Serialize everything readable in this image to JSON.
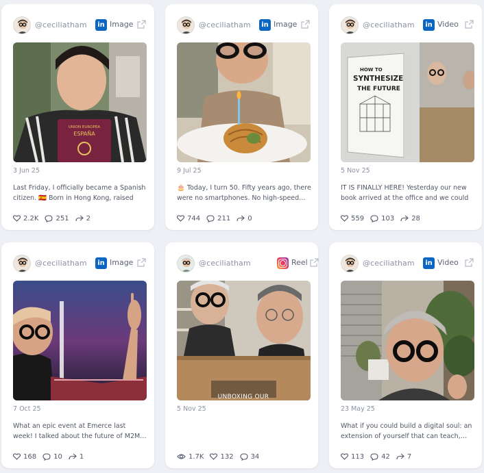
{
  "posts": [
    {
      "handle": "@ceciliatham",
      "platform": "linkedin",
      "media_type": "Image",
      "date": "3 Jun 25",
      "caption": "Last Friday, I officially became a Spanish citizen. 🇪🇸 Born in Hong Kong, raised in…",
      "stats": {
        "likes": "2.2K",
        "comments": "251",
        "shares": "2"
      },
      "thumbnail_text": {
        "passport_line1": "UNION EUROPEA",
        "passport_line2": "ESPAÑA"
      }
    },
    {
      "handle": "@ceciliatham",
      "platform": "linkedin",
      "media_type": "Image",
      "date": "9 Jul 25",
      "caption": "🎂 Today, I turn 50. Fifty years ago, there were no smartphones. No high-speed…",
      "stats": {
        "likes": "744",
        "comments": "211",
        "shares": "0"
      }
    },
    {
      "handle": "@ceciliatham",
      "platform": "linkedin",
      "media_type": "Video",
      "date": "5 Nov 25",
      "caption": "IT IS FINALLY HERE! Yesterday our new book arrived at the office and we could not be…",
      "stats": {
        "likes": "559",
        "comments": "103",
        "shares": "28"
      },
      "thumbnail_text": {
        "book_title_1": "HOW TO",
        "book_title_2": "SYNTHESIZE",
        "book_title_3": "THE FUTURE"
      }
    },
    {
      "handle": "@ceciliatham",
      "platform": "linkedin",
      "media_type": "Image",
      "date": "7 Oct 25",
      "caption": "What an epic event at Emerce last week! I talked about the future of M2M…",
      "stats": {
        "likes": "168",
        "comments": "10",
        "shares": "1"
      }
    },
    {
      "handle": "@ceciliatham",
      "platform": "instagram",
      "media_type": "Reel",
      "date": "5 Nov 25",
      "caption": "",
      "stats": {
        "views": "1.7K",
        "likes": "132",
        "comments": "34"
      },
      "thumbnail_text": {
        "overlay": "UNBOXING OUR"
      }
    },
    {
      "handle": "@ceciliatham",
      "platform": "linkedin",
      "media_type": "Video",
      "date": "23 May 25",
      "caption": "What if you could build a digital soul: an extension of yourself that can teach,…",
      "stats": {
        "likes": "113",
        "comments": "42",
        "shares": "7"
      }
    }
  ],
  "icons": {
    "linkedin": "linkedin-icon",
    "instagram": "instagram-icon",
    "external": "external-link-icon",
    "like": "heart-icon",
    "comment": "comment-icon",
    "share": "share-icon",
    "views": "eye-icon"
  },
  "colors": {
    "background": "#eef0f5",
    "card": "#ffffff",
    "linkedin": "#0a66c2",
    "text": "#4f5666",
    "muted": "#8b91a1"
  }
}
